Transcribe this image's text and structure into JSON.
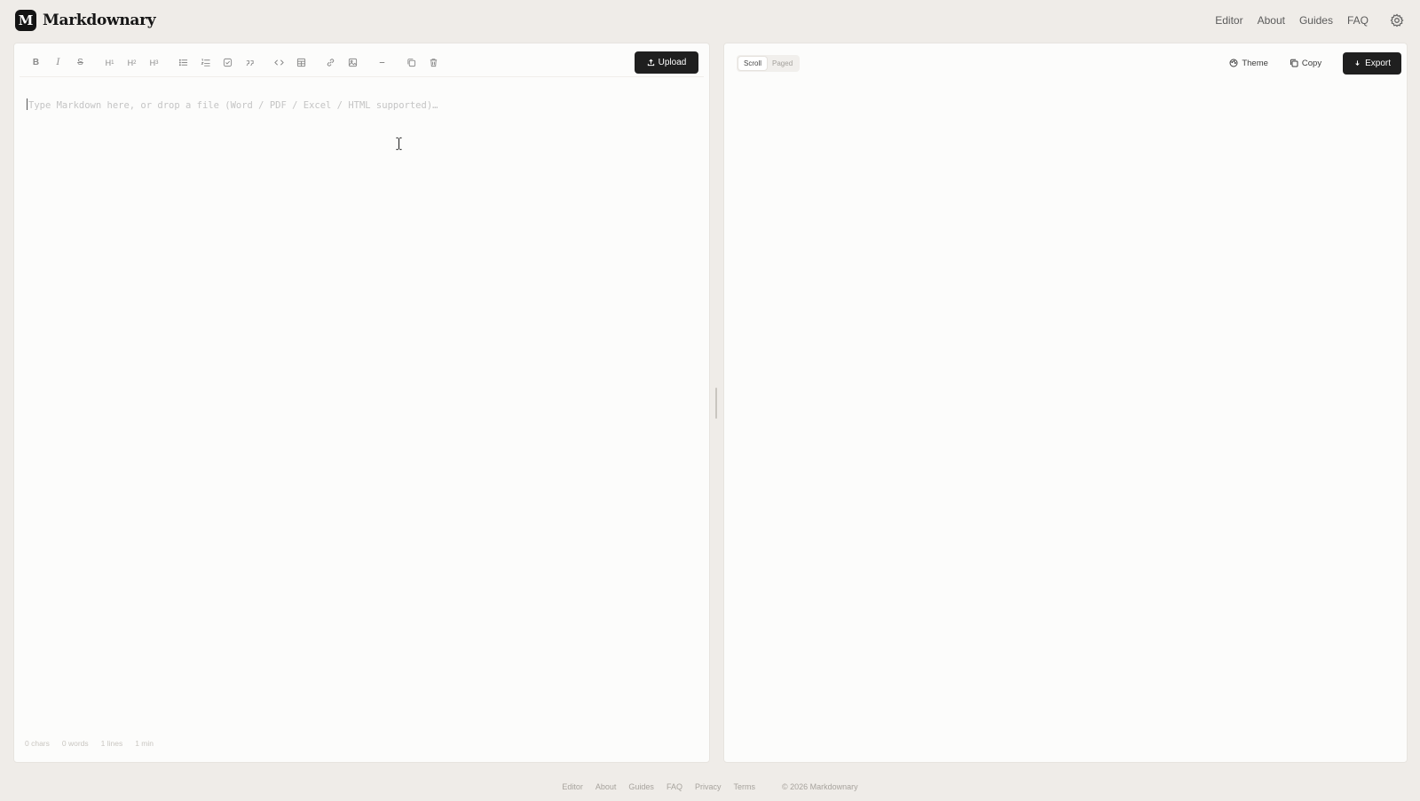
{
  "header": {
    "logo_letter": "M",
    "brand_name": "Markdownary",
    "nav": [
      "Editor",
      "About",
      "Guides",
      "FAQ"
    ]
  },
  "editor": {
    "toolbar": {
      "upload_label": "Upload"
    },
    "placeholder": "Type Markdown here, or drop a file (Word / PDF / Excel / HTML supported)…",
    "stats": [
      "0 chars",
      "0 words",
      "1 lines",
      "1 min"
    ]
  },
  "preview": {
    "modes": [
      "Scroll",
      "Paged"
    ],
    "theme_label": "Theme",
    "copy_label": "Copy",
    "export_label": "Export"
  },
  "footer": {
    "links": [
      "Editor",
      "About",
      "Guides",
      "FAQ",
      "Privacy",
      "Terms"
    ],
    "copyright": "© 2026 Markdownary"
  },
  "colors": {
    "page_bg": "#efece8",
    "panel_bg": "#fcfcfb",
    "primary_button": "#1f1f1f"
  }
}
